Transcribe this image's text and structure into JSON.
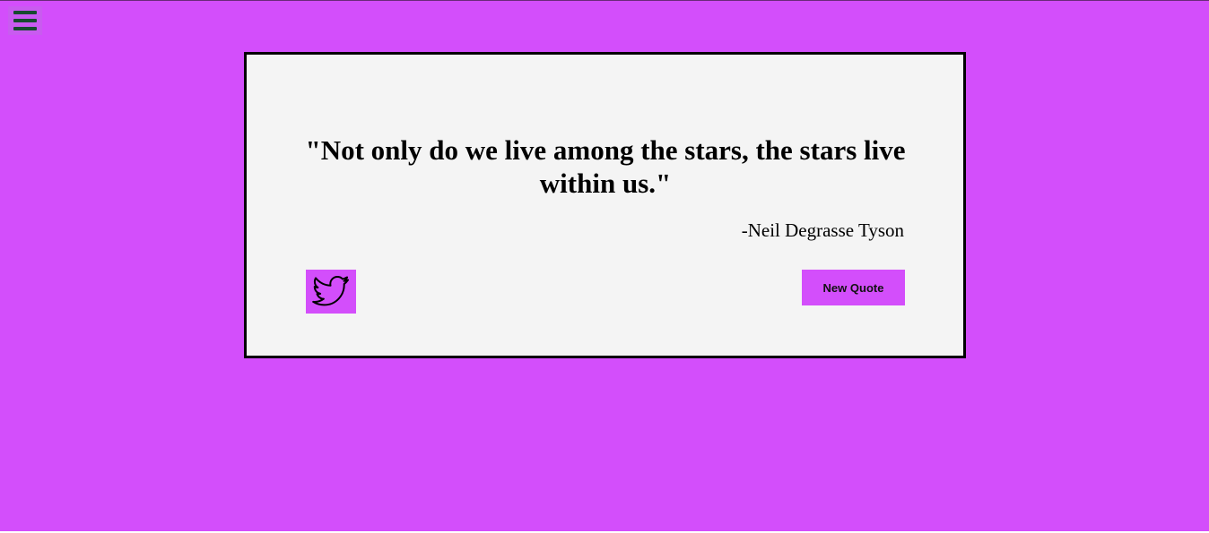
{
  "colors": {
    "page_background": "#d34efb",
    "menu_button_background": "#c95bf0",
    "menu_icon_color": "#174a2e",
    "card_background": "#f4f4f4",
    "card_border": "#000000",
    "button_background": "#d34efb"
  },
  "menu": {
    "icon": "hamburger-menu-icon"
  },
  "quote": {
    "text": "\"Not only do we live among the stars, the stars live within us.\"",
    "author": "-Neil Degrasse Tyson"
  },
  "actions": {
    "tweet_icon": "twitter-bird-icon",
    "new_quote_label": "New Quote"
  }
}
